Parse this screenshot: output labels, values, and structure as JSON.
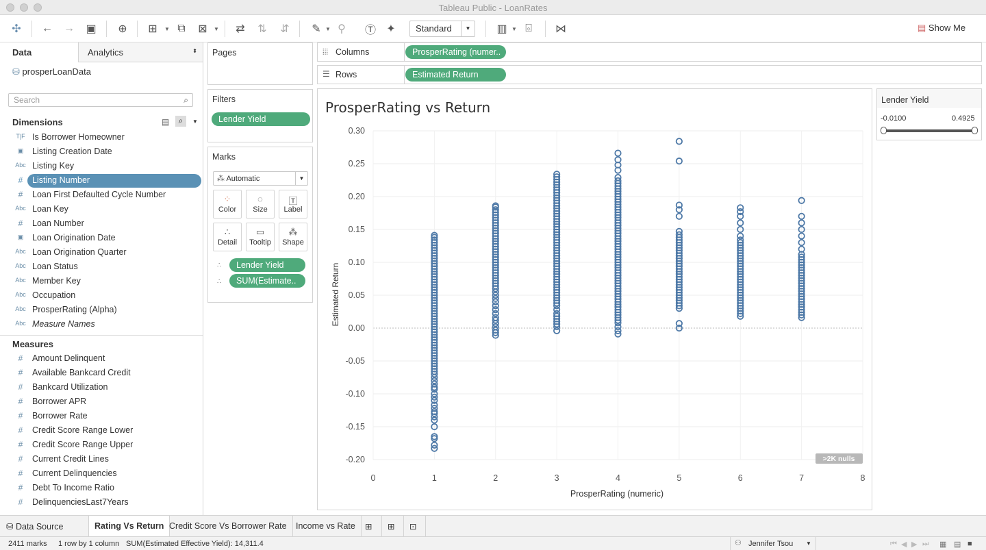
{
  "window": {
    "title": "Tableau Public - LoanRates"
  },
  "toolbar": {
    "fit_mode": "Standard",
    "show_me": "Show Me"
  },
  "data_pane": {
    "tab_data": "Data",
    "tab_analytics": "Analytics",
    "datasource": "prosperLoanData",
    "search_placeholder": "Search",
    "dimensions_header": "Dimensions",
    "dimensions": [
      {
        "type": "T|F",
        "name": "Is Borrower Homeowner"
      },
      {
        "type": "date",
        "name": "Listing Creation Date"
      },
      {
        "type": "Abc",
        "name": "Listing Key"
      },
      {
        "type": "#",
        "name": "Listing Number",
        "selected": true
      },
      {
        "type": "#",
        "name": "Loan First Defaulted Cycle Number"
      },
      {
        "type": "Abc",
        "name": "Loan Key"
      },
      {
        "type": "#",
        "name": "Loan Number"
      },
      {
        "type": "date",
        "name": "Loan Origination Date"
      },
      {
        "type": "Abc",
        "name": "Loan Origination Quarter"
      },
      {
        "type": "Abc",
        "name": "Loan Status"
      },
      {
        "type": "Abc",
        "name": "Member Key"
      },
      {
        "type": "Abc",
        "name": "Occupation"
      },
      {
        "type": "Abc",
        "name": "ProsperRating (Alpha)"
      },
      {
        "type": "Abc",
        "name": "Measure Names",
        "italic": true
      }
    ],
    "measures_header": "Measures",
    "measures": [
      {
        "type": "#",
        "name": "Amount Delinquent"
      },
      {
        "type": "#",
        "name": "Available Bankcard Credit"
      },
      {
        "type": "#",
        "name": "Bankcard Utilization"
      },
      {
        "type": "#",
        "name": "Borrower APR"
      },
      {
        "type": "#",
        "name": "Borrower Rate"
      },
      {
        "type": "#",
        "name": "Credit Score Range Lower"
      },
      {
        "type": "#",
        "name": "Credit Score Range Upper"
      },
      {
        "type": "#",
        "name": "Current Credit Lines"
      },
      {
        "type": "#",
        "name": "Current Delinquencies"
      },
      {
        "type": "#",
        "name": "Debt To Income Ratio"
      },
      {
        "type": "#",
        "name": "DelinquenciesLast7Years"
      }
    ]
  },
  "shelves": {
    "pages": "Pages",
    "filters": "Filters",
    "filter_pill": "Lender Yield",
    "marks": "Marks",
    "mark_type": "Automatic",
    "mark_buttons": [
      "Color",
      "Size",
      "Label",
      "Detail",
      "Tooltip",
      "Shape"
    ],
    "mark_pills": [
      "Lender Yield",
      "SUM(Estimate.."
    ],
    "columns_label": "Columns",
    "columns_pill": "ProsperRating (numer..",
    "rows_label": "Rows",
    "rows_pill": "Estimated Return"
  },
  "legend": {
    "title": "Lender Yield",
    "min": "-0.0100",
    "max": "0.4925"
  },
  "chart_data": {
    "type": "scatter",
    "title": "ProsperRating vs Return",
    "xlabel": "ProsperRating (numeric)",
    "ylabel": "Estimated Return",
    "xlim": [
      0,
      8
    ],
    "ylim": [
      -0.2,
      0.3
    ],
    "x_ticks": [
      "0",
      "1",
      "2",
      "3",
      "4",
      "5",
      "6",
      "7",
      "8"
    ],
    "y_ticks": [
      "0.30",
      "0.25",
      "0.20",
      "0.15",
      "0.10",
      "0.05",
      "0.00",
      "-0.05",
      "-0.10",
      "-0.15",
      "-0.20"
    ],
    "null_badge": ">2K nulls",
    "marker_color": "#4e79a7",
    "series": [
      {
        "x": 1,
        "y": [
          -0.183,
          -0.178,
          -0.168,
          -0.165,
          -0.15,
          -0.14,
          -0.135,
          -0.13,
          -0.127,
          -0.122,
          -0.117,
          -0.11,
          -0.105,
          -0.1,
          -0.093,
          -0.09,
          -0.085,
          -0.08,
          -0.075,
          -0.07,
          -0.066,
          -0.062,
          -0.058,
          -0.054,
          -0.05,
          -0.046,
          -0.042,
          -0.038,
          -0.034,
          -0.03,
          -0.026,
          -0.022,
          -0.018,
          -0.014,
          -0.01,
          -0.006,
          -0.002,
          0.002,
          0.006,
          0.01,
          0.014,
          0.018,
          0.022,
          0.026,
          0.03,
          0.034,
          0.038,
          0.042,
          0.046,
          0.05,
          0.054,
          0.058,
          0.062,
          0.066,
          0.07,
          0.074,
          0.078,
          0.082,
          0.086,
          0.09,
          0.094,
          0.098,
          0.102,
          0.106,
          0.11,
          0.114,
          0.118,
          0.122,
          0.126,
          0.13,
          0.134,
          0.138,
          0.141
        ]
      },
      {
        "x": 2,
        "y": [
          -0.011,
          -0.007,
          -0.003,
          0.002,
          0.007,
          0.012,
          0.016,
          0.022,
          0.028,
          0.034,
          0.04,
          0.045,
          0.05,
          0.055,
          0.06,
          0.064,
          0.068,
          0.072,
          0.076,
          0.08,
          0.084,
          0.088,
          0.092,
          0.096,
          0.1,
          0.104,
          0.108,
          0.112,
          0.116,
          0.12,
          0.124,
          0.128,
          0.132,
          0.136,
          0.14,
          0.144,
          0.148,
          0.152,
          0.156,
          0.16,
          0.164,
          0.168,
          0.172,
          0.176,
          0.18,
          0.184,
          0.186
        ]
      },
      {
        "x": 3,
        "y": [
          -0.004,
          0.002,
          0.006,
          0.01,
          0.014,
          0.018,
          0.022,
          0.028,
          0.034,
          0.038,
          0.042,
          0.046,
          0.05,
          0.054,
          0.058,
          0.062,
          0.066,
          0.07,
          0.074,
          0.078,
          0.082,
          0.086,
          0.09,
          0.094,
          0.098,
          0.102,
          0.106,
          0.11,
          0.114,
          0.118,
          0.122,
          0.126,
          0.13,
          0.134,
          0.138,
          0.142,
          0.146,
          0.15,
          0.154,
          0.158,
          0.162,
          0.166,
          0.17,
          0.174,
          0.178,
          0.182,
          0.186,
          0.19,
          0.194,
          0.198,
          0.202,
          0.206,
          0.21,
          0.214,
          0.218,
          0.222,
          0.226,
          0.23,
          0.234
        ]
      },
      {
        "x": 4,
        "y": [
          -0.009,
          -0.004,
          0.002,
          0.008,
          0.012,
          0.016,
          0.02,
          0.024,
          0.028,
          0.032,
          0.036,
          0.04,
          0.044,
          0.048,
          0.052,
          0.056,
          0.06,
          0.064,
          0.068,
          0.072,
          0.076,
          0.08,
          0.084,
          0.088,
          0.092,
          0.096,
          0.1,
          0.104,
          0.108,
          0.112,
          0.116,
          0.12,
          0.124,
          0.128,
          0.132,
          0.136,
          0.14,
          0.144,
          0.148,
          0.152,
          0.156,
          0.16,
          0.164,
          0.168,
          0.172,
          0.176,
          0.18,
          0.184,
          0.188,
          0.192,
          0.196,
          0.2,
          0.204,
          0.208,
          0.212,
          0.216,
          0.22,
          0.224,
          0.229,
          0.24,
          0.248,
          0.256,
          0.266
        ]
      },
      {
        "x": 5,
        "y": [
          0.0,
          0.007,
          0.03,
          0.034,
          0.038,
          0.042,
          0.046,
          0.05,
          0.054,
          0.058,
          0.062,
          0.066,
          0.07,
          0.074,
          0.078,
          0.082,
          0.086,
          0.09,
          0.094,
          0.098,
          0.102,
          0.106,
          0.11,
          0.114,
          0.118,
          0.122,
          0.126,
          0.13,
          0.134,
          0.138,
          0.142,
          0.147,
          0.17,
          0.18,
          0.187,
          0.254,
          0.284
        ]
      },
      {
        "x": 6,
        "y": [
          0.018,
          0.022,
          0.026,
          0.03,
          0.034,
          0.038,
          0.042,
          0.046,
          0.05,
          0.054,
          0.058,
          0.062,
          0.066,
          0.07,
          0.074,
          0.078,
          0.082,
          0.086,
          0.09,
          0.094,
          0.098,
          0.102,
          0.106,
          0.11,
          0.114,
          0.118,
          0.122,
          0.126,
          0.13,
          0.134,
          0.14,
          0.15,
          0.16,
          0.17,
          0.177,
          0.183
        ]
      },
      {
        "x": 7,
        "y": [
          0.016,
          0.02,
          0.024,
          0.028,
          0.032,
          0.036,
          0.04,
          0.044,
          0.048,
          0.052,
          0.056,
          0.06,
          0.064,
          0.068,
          0.072,
          0.076,
          0.08,
          0.084,
          0.088,
          0.092,
          0.096,
          0.1,
          0.104,
          0.108,
          0.112,
          0.12,
          0.13,
          0.14,
          0.15,
          0.16,
          0.17,
          0.194
        ]
      }
    ]
  },
  "sheet_tabs": {
    "data_source": "Data Source",
    "tabs": [
      "Rating Vs Return",
      "Credit Score Vs Borrower Rate",
      "Income vs Rate"
    ]
  },
  "status": {
    "marks": "2411 marks",
    "dims": "1 row by 1 column",
    "sum": "SUM(Estimated Effective Yield): 14,311.4",
    "user": "Jennifer Tsou"
  }
}
